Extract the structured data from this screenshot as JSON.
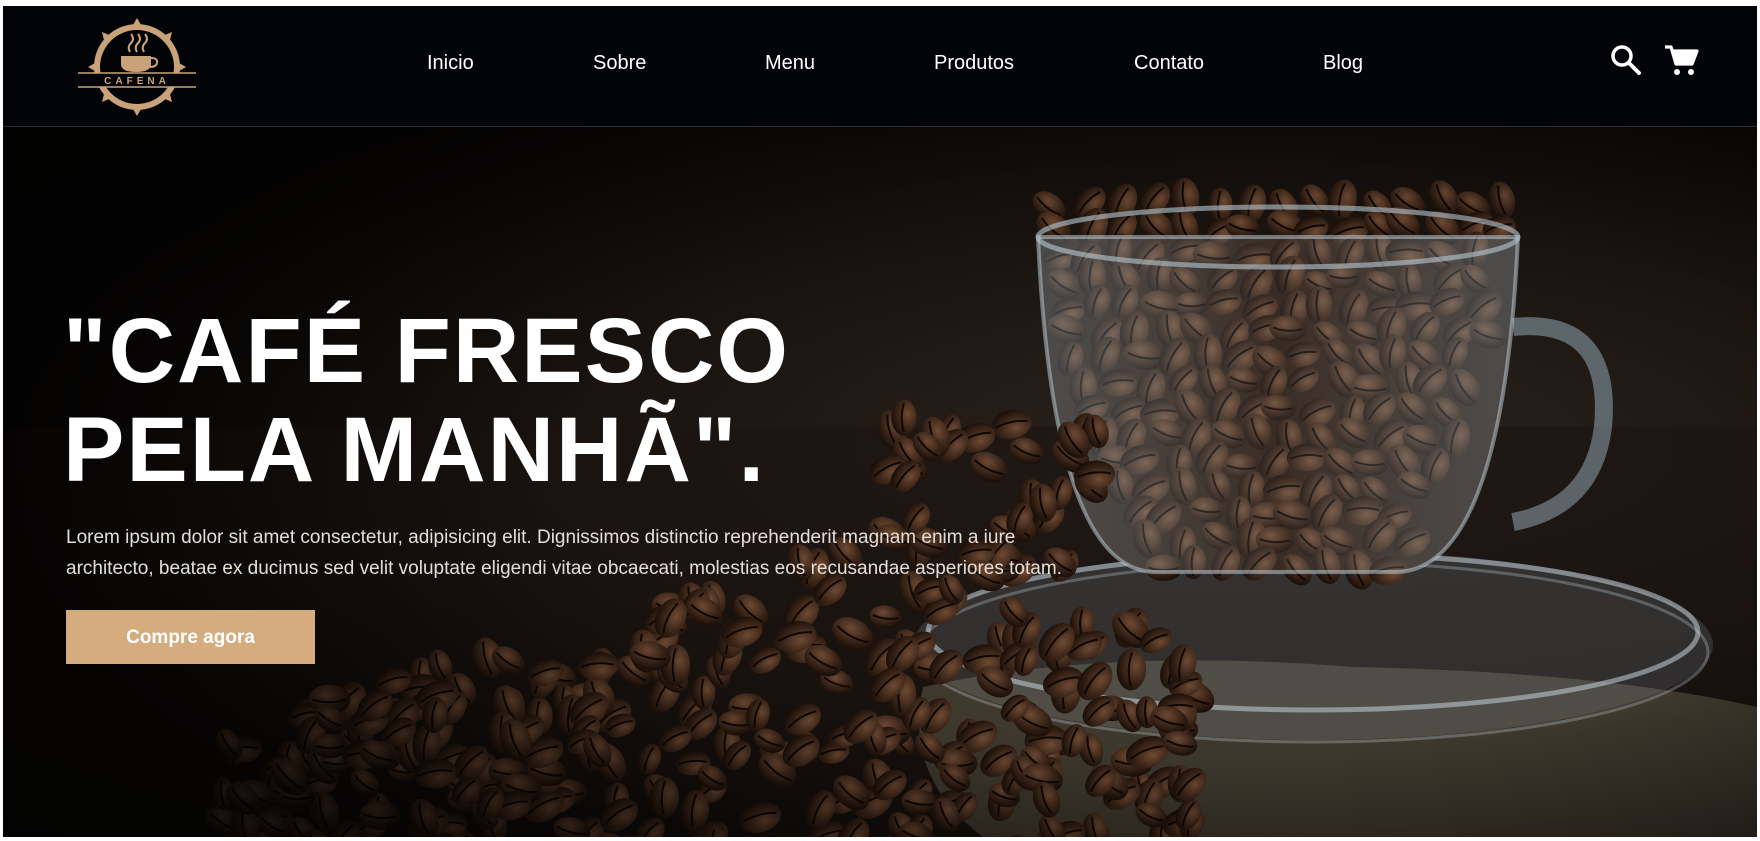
{
  "brand": {
    "logo_text": "CAFENA",
    "accent": "#d4ac7e"
  },
  "nav": {
    "items": [
      {
        "label": "Inicio"
      },
      {
        "label": "Sobre"
      },
      {
        "label": "Menu"
      },
      {
        "label": "Produtos"
      },
      {
        "label": "Contato"
      },
      {
        "label": "Blog"
      }
    ]
  },
  "header_icons": {
    "search": "search-icon",
    "cart": "cart-icon"
  },
  "hero": {
    "title_line1": "\"CAFÉ FRESCO",
    "title_line2": "PELA MANHÃ\".",
    "description": "Lorem ipsum dolor sit amet consectetur, adipisicing elit. Dignissimos distinctio reprehenderit magnam enim a iure architecto, beatae ex ducimus sed velit voluptate eligendi vitae obcaecati, molestias eos recusandae asperiores totam.",
    "cta_label": "Compre agora"
  }
}
